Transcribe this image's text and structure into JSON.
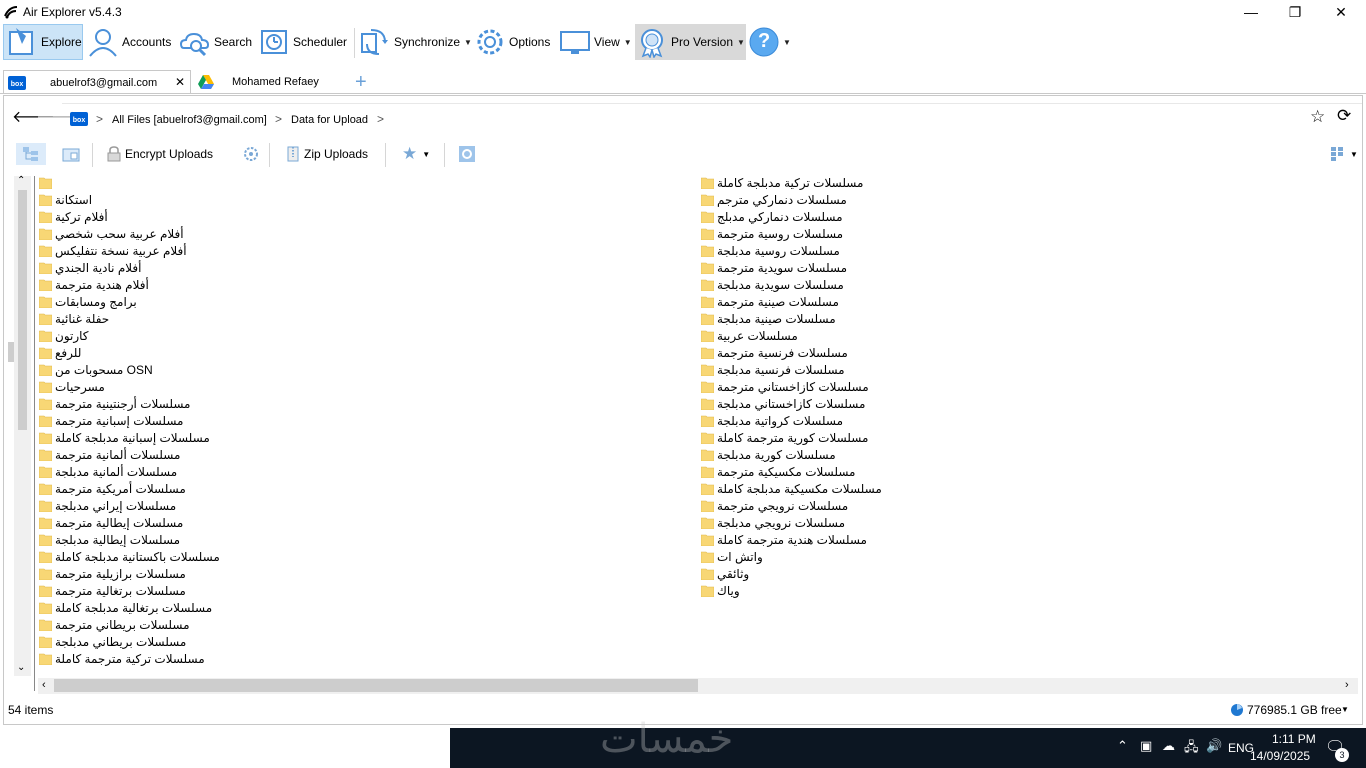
{
  "window": {
    "title": "Air Explorer v5.4.3",
    "minimize": "—",
    "maximize": "❐",
    "close": "✕"
  },
  "toolbar": {
    "explore": "Explore",
    "accounts": "Accounts",
    "search": "Search",
    "scheduler": "Scheduler",
    "synchronize": "Synchronize",
    "options": "Options",
    "view": "View",
    "pro": "Pro Version",
    "help": "?"
  },
  "tabs": [
    {
      "label": "abuelrof3@gmail.com",
      "service": "box"
    },
    {
      "label": "Mohamed Refaey",
      "service": "google-drive"
    }
  ],
  "breadcrumb": {
    "root": "All Files [abuelrof3@gmail.com]",
    "current": "Data for Upload"
  },
  "toolbar2": {
    "encrypt": "Encrypt Uploads",
    "zip": "Zip Uploads"
  },
  "files_left": [
    "",
    "استكانة",
    "أفلام تركية",
    "أفلام عربية سحب شخصي",
    "أفلام عربية نسخة نتفليكس",
    "أفلام نادية الجندي",
    "أفلام هندية مترجمة",
    "برامج ومسابقات",
    "حفلة غنائية",
    "كارتون",
    "للرفع",
    "مسحوبات من OSN",
    "مسرحيات",
    "مسلسلات أرجنتينية مترجمة",
    "مسلسلات إسبانية مترجمة",
    "مسلسلات إسبانية مدبلجة كاملة",
    "مسلسلات ألمانية مترجمة",
    "مسلسلات ألمانية مدبلجة",
    "مسلسلات أمريكية مترجمة",
    "مسلسلات إيراني مدبلجة",
    "مسلسلات إيطالية مترجمة",
    "مسلسلات إيطالية مدبلجة",
    "مسلسلات باكستانية مدبلجة كاملة",
    "مسلسلات برازيلية مترجمة",
    "مسلسلات برتغالية مترجمة",
    "مسلسلات برتغالية مدبلجة كاملة",
    "مسلسلات بريطاني مترجمة",
    "مسلسلات بريطاني مدبلجة",
    "مسلسلات تركية مترجمة كاملة"
  ],
  "files_right": [
    "مسلسلات تركية مدبلجة كاملة",
    "مسلسلات دنماركي مترجم",
    "مسلسلات دنماركي مدبلج",
    "مسلسلات روسية مترجمة",
    "مسلسلات روسية مدبلجة",
    "مسلسلات سويدية مترجمة",
    "مسلسلات سويدية مدبلجة",
    "مسلسلات صينية مترجمة",
    "مسلسلات صينية مدبلجة",
    "مسلسلات عربية",
    "مسلسلات فرنسية مترجمة",
    "مسلسلات فرنسية مدبلجة",
    "مسلسلات كازاخستاني مترجمة",
    "مسلسلات كازاخستاني مدبلجة",
    "مسلسلات كرواتية مدبلجة",
    "مسلسلات كورية مترجمة كاملة",
    "مسلسلات كورية مدبلجة",
    "مسلسلات مكسيكية مترجمة",
    "مسلسلات مكسيكية مدبلجة كاملة",
    "مسلسلات نرويجي مترجمة",
    "مسلسلات نرويجي مدبلجة",
    "مسلسلات هندية مترجمة كاملة",
    "واتش ات",
    "وثائقي",
    "وياك"
  ],
  "status": {
    "items": "54 items",
    "free": "776985.1 GB free"
  },
  "taskbar": {
    "watermark": "خمسات",
    "language": "ENG",
    "time": "1:11 PM",
    "date": "14/09/2025",
    "notifications": "3"
  },
  "colors": {
    "accent": "#1f78d1",
    "folder": "#f8d775",
    "taskbar": "#0c1622",
    "box_brand": "#0061d5"
  }
}
